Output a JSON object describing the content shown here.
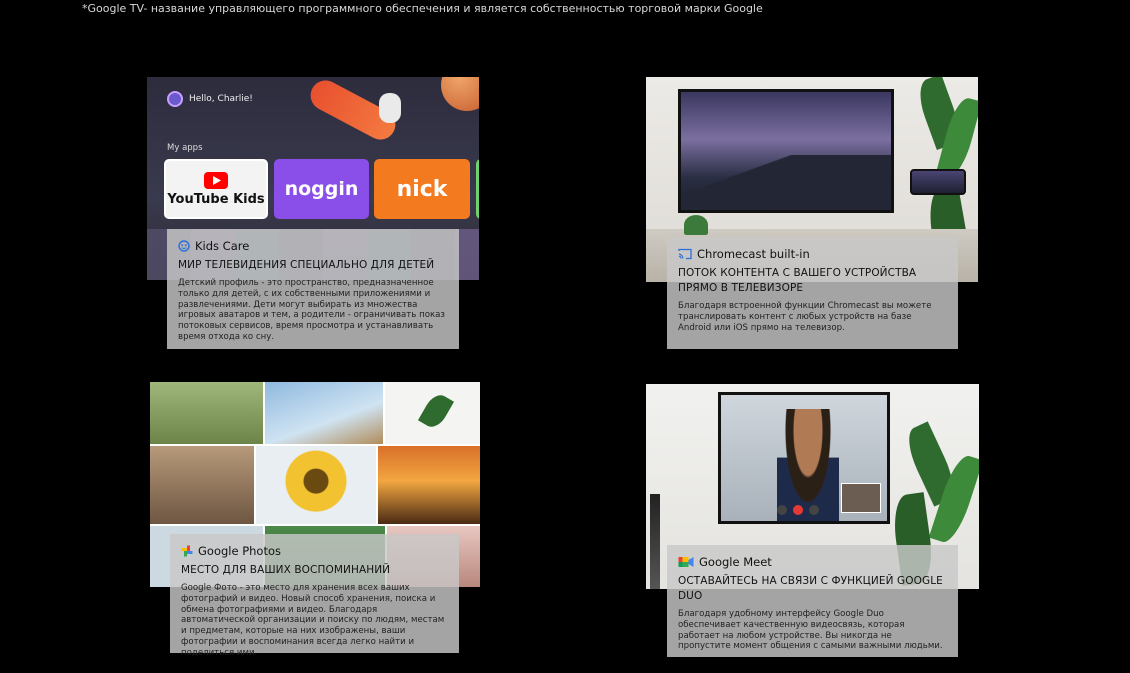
{
  "footnote": "*Google TV- название управляющего программного обеспечения и является собственностью торговой марки Google",
  "tiles": [
    {
      "brand": "Kids Care",
      "title": "МИР ТЕЛЕВИДЕНИЯ СПЕЦИАЛЬНО ДЛЯ ДЕТЕЙ",
      "body": "Детский профиль - это пространство, предназначенное только для детей, с их собственными приложениями и развлечениями. Дети могут выбирать из множества игровых аватаров и тем, а родители - ограничивать показ потоковых сервисов, время просмотра и устанавливать время отхода ко сну.",
      "screen": {
        "greeting": "Hello, Charlie!",
        "section": "My apps",
        "apps": [
          "YouTube Kids",
          "noggin",
          "nick"
        ]
      }
    },
    {
      "brand": "Chromecast built-in",
      "title": "ПОТОК КОНТЕНТА С ВАШЕГО УСТРОЙСТВА ПРЯМО В ТЕЛЕВИЗОРЕ",
      "body": "Благодаря встроенной функции Chromecast вы можете транслировать контент с любых устройств на базе Android или iOS прямо на телевизор."
    },
    {
      "brand": "Google Photos",
      "title": "МЕСТО ДЛЯ ВАШИХ ВОСПОМИНАНИЙ",
      "body": "Google Фото - это место для хранения всех ваших фотографий и видео. Новый способ хранения, поиска и обмена фотографиями и видео. Благодаря автоматической организации и поиску по людям, местам и предметам, которые на них изображены, ваши фотографии и воспоминания всегда легко найти и поделиться ими."
    },
    {
      "brand": "Google Meet",
      "title": "ОСТАВАЙТЕСЬ НА СВЯЗИ С ФУНКЦИЕЙ GOOGLE DUO",
      "body": "Благодаря удобному интерфейсу Google Duo обеспечивает качественную видеосвязь, которая работает на любом устройстве. Вы никогда не пропустите момент общения с самыми важными людьми."
    }
  ],
  "colors": {
    "background": "#000000",
    "card": "#c8c8c8",
    "youtube_red": "#ff0000",
    "noggin_purple": "#8a4fe8",
    "nick_orange": "#f47a20"
  },
  "icons": [
    "kids-care-icon",
    "cast-icon",
    "google-photos-icon",
    "google-meet-icon"
  ]
}
